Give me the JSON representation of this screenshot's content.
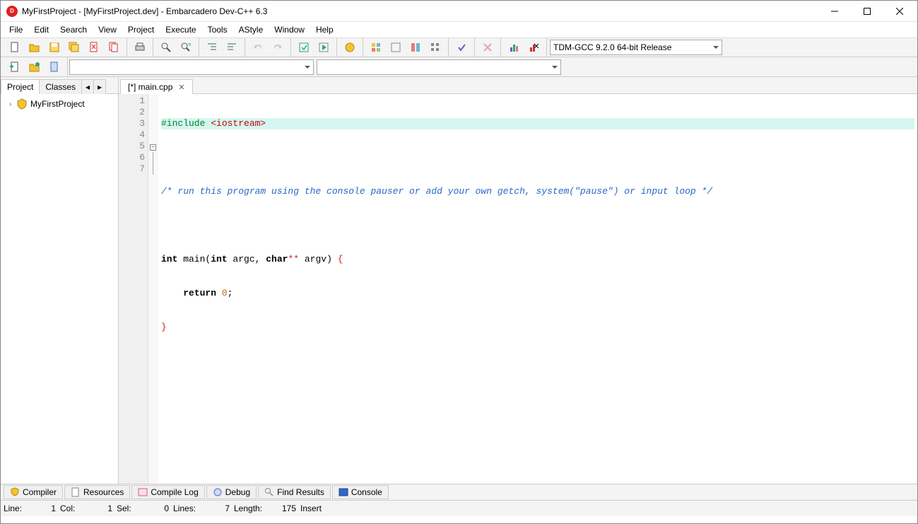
{
  "title": "MyFirstProject - [MyFirstProject.dev] - Embarcadero Dev-C++ 6.3",
  "menus": [
    "File",
    "Edit",
    "Search",
    "View",
    "Project",
    "Execute",
    "Tools",
    "AStyle",
    "Window",
    "Help"
  ],
  "compiler": "TDM-GCC 9.2.0 64-bit Release",
  "sidebar": {
    "tabs": {
      "project": "Project",
      "classes": "Classes"
    },
    "root": "MyFirstProject"
  },
  "editor": {
    "tab": "[*] main.cpp",
    "lines": [
      1,
      2,
      3,
      4,
      5,
      6,
      7
    ]
  },
  "code": {
    "l1a": "#include ",
    "l1b": "<iostream>",
    "l3": "/* run this program using the console pauser or add your own getch, system(\"pause\") or input loop */",
    "l5_int": "int",
    "l5_main": " main(",
    "l5_int2": "int",
    "l5_argc": " argc, ",
    "l5_char": "char",
    "l5_star": "**",
    "l5_argv": " argv) ",
    "l5_brace": "{",
    "l6_ret": "return",
    "l6_zero": "0",
    "l6_semi": ";",
    "l7": "}"
  },
  "bottom_tabs": {
    "compiler": "Compiler",
    "resources": "Resources",
    "compile_log": "Compile Log",
    "debug": "Debug",
    "find_results": "Find Results",
    "console": "Console"
  },
  "status": {
    "line_label": "Line:",
    "line": "1",
    "col_label": "Col:",
    "col": "1",
    "sel_label": "Sel:",
    "sel": "0",
    "lines_label": "Lines:",
    "lines": "7",
    "length_label": "Length:",
    "length": "175",
    "mode": "Insert"
  }
}
